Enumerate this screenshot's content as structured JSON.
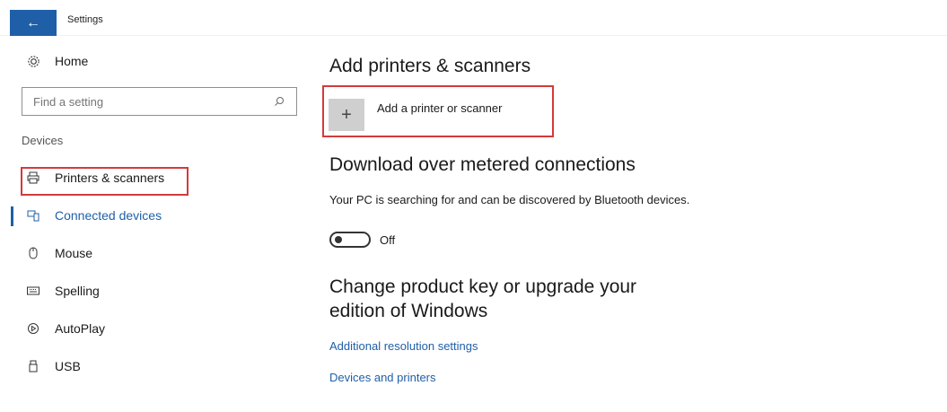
{
  "window": {
    "title": "Settings",
    "back_icon": "←"
  },
  "sidebar": {
    "home_label": "Home",
    "search_placeholder": "Find a setting",
    "section_label": "Devices",
    "items": [
      {
        "label": "Printers & scanners",
        "icon": "printer-icon",
        "glyph": "🖶"
      },
      {
        "label": "Connected devices",
        "icon": "connected-devices-icon",
        "glyph": "⧉",
        "active": true
      },
      {
        "label": "Mouse",
        "icon": "mouse-icon",
        "glyph": "◯"
      },
      {
        "label": "Spelling",
        "icon": "keyboard-icon",
        "glyph": "⌨"
      },
      {
        "label": "AutoPlay",
        "icon": "autoplay-icon",
        "glyph": "⊙"
      },
      {
        "label": "USB",
        "icon": "usb-icon",
        "glyph": "▯"
      }
    ]
  },
  "main": {
    "add_section": {
      "heading": "Add printers & scanners",
      "add_label": "Add a printer or scanner",
      "plus_glyph": "+"
    },
    "download_section": {
      "heading": "Download over metered connections",
      "description": "Your PC is searching for and can be discovered by Bluetooth devices.",
      "toggle_label": "Off"
    },
    "product_section": {
      "heading_line1": "Change product key or upgrade your",
      "heading_line2": "edition of Windows"
    },
    "links": [
      "Additional resolution settings",
      "Devices and printers"
    ]
  },
  "colors": {
    "accent": "#1f5fa8",
    "highlight": "#d33b3b"
  }
}
